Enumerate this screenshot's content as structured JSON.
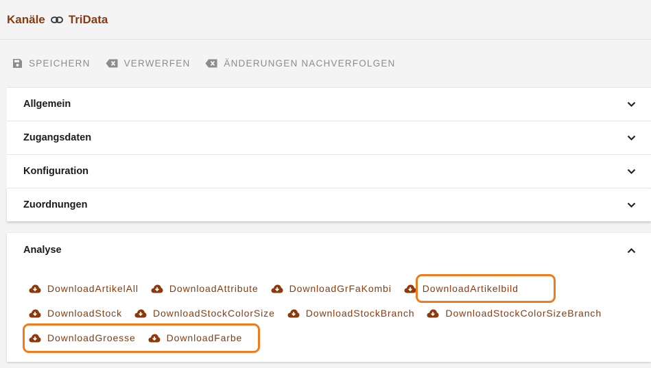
{
  "header": {
    "title_left": "Kanäle",
    "title_right": "TriData"
  },
  "toolbar": {
    "save_label": "SPEICHERN",
    "discard_label": "VERWERFEN",
    "track_label": "ÄNDERUNGEN NACHVERFOLGEN"
  },
  "panels": [
    {
      "title": "Allgemein"
    },
    {
      "title": "Zugangsdaten"
    },
    {
      "title": "Konfiguration"
    },
    {
      "title": "Zuordnungen"
    }
  ],
  "analyse": {
    "title": "Analyse",
    "downloads": [
      "DownloadArtikelAll",
      "DownloadAttribute",
      "DownloadGrFaKombi",
      "DownloadArtikelbild",
      "DownloadStock",
      "DownloadStockColorSize",
      "DownloadStockBranch",
      "DownloadStockColorSizeBranch",
      "DownloadGroesse",
      "DownloadFarbe"
    ]
  },
  "colors": {
    "accent": "#8a3a0c",
    "highlight": "#f27a1a",
    "toolbar_text": "#8c8c8c"
  }
}
